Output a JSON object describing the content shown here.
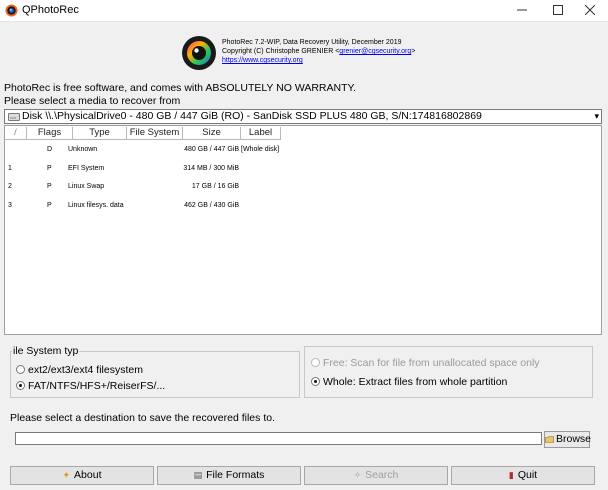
{
  "window": {
    "title": "QPhotoRec"
  },
  "header": {
    "line1": "PhotoRec 7.2-WIP, Data Recovery Utility, December 2019",
    "line2_prefix": "Copyright (C) Christophe GRENIER <",
    "email": "grenier@cgsecurity.org",
    "line2_suffix": ">",
    "website": "https://www.cgsecurity.org"
  },
  "intro": {
    "license": "PhotoRec is free software, and comes with ABSOLUTELY NO WARRANTY.",
    "select_media": "Please select a media to recover from"
  },
  "disk_select": {
    "value": "Disk \\\\.\\PhysicalDrive0 - 480 GB / 447 GiB (RO) - SanDisk SSD PLUS 480 GB, S/N:174816802869"
  },
  "partitions": {
    "columns": [
      "/",
      "Flags",
      "Type",
      "File System",
      "Size",
      "Label"
    ],
    "rows": [
      {
        "num": "",
        "flag": "D",
        "type": "Unknown",
        "fs": "",
        "size": "480 GB / 447 GiB",
        "label": "[Whole disk]"
      },
      {
        "num": "1",
        "flag": "P",
        "type": "EFI System",
        "fs": "",
        "size": "314 MB / 300 MiB",
        "label": ""
      },
      {
        "num": "2",
        "flag": "P",
        "type": "Linux Swap",
        "fs": "",
        "size": "17 GB / 16 GiB",
        "label": ""
      },
      {
        "num": "3",
        "flag": "P",
        "type": "Linux filesys. data",
        "fs": "",
        "size": "462 GB / 430 GiB",
        "label": ""
      }
    ]
  },
  "fs_type": {
    "title": "ile System typ",
    "options": [
      "ext2/ext3/ext4 filesystem",
      "FAT/NTFS/HFS+/ReiserFS/..."
    ],
    "selected": 1
  },
  "scan_mode": {
    "options": [
      "Free: Scan for file from unallocated space only",
      "Whole: Extract files from whole partition"
    ],
    "selected": 1
  },
  "destination": {
    "label": "Please select a destination to save the recovered files to.",
    "value": "",
    "browse_label": "Browse"
  },
  "buttons": {
    "about": "About",
    "formats": "File Formats",
    "search": "Search",
    "quit": "Quit"
  }
}
